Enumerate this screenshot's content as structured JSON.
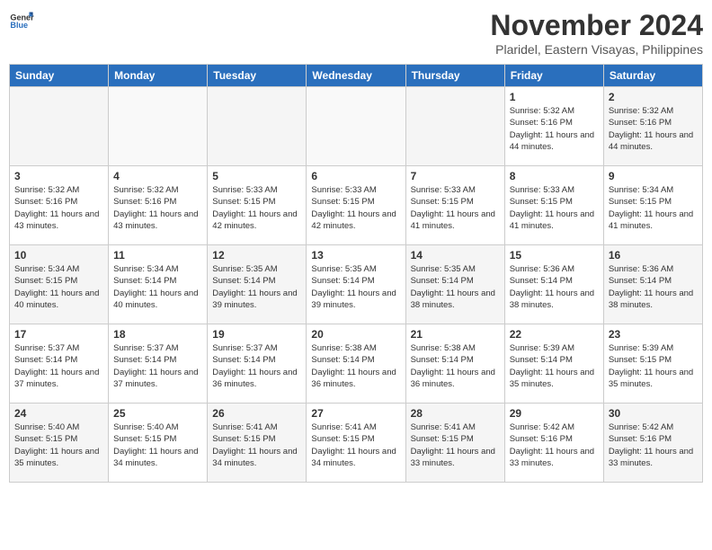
{
  "header": {
    "logo_line1": "General",
    "logo_line2": "Blue",
    "month": "November 2024",
    "location": "Plaridel, Eastern Visayas, Philippines"
  },
  "weekdays": [
    "Sunday",
    "Monday",
    "Tuesday",
    "Wednesday",
    "Thursday",
    "Friday",
    "Saturday"
  ],
  "weeks": [
    [
      {
        "day": "",
        "info": ""
      },
      {
        "day": "",
        "info": ""
      },
      {
        "day": "",
        "info": ""
      },
      {
        "day": "",
        "info": ""
      },
      {
        "day": "",
        "info": ""
      },
      {
        "day": "1",
        "info": "Sunrise: 5:32 AM\nSunset: 5:16 PM\nDaylight: 11 hours\nand 44 minutes."
      },
      {
        "day": "2",
        "info": "Sunrise: 5:32 AM\nSunset: 5:16 PM\nDaylight: 11 hours\nand 44 minutes."
      }
    ],
    [
      {
        "day": "3",
        "info": "Sunrise: 5:32 AM\nSunset: 5:16 PM\nDaylight: 11 hours\nand 43 minutes."
      },
      {
        "day": "4",
        "info": "Sunrise: 5:32 AM\nSunset: 5:16 PM\nDaylight: 11 hours\nand 43 minutes."
      },
      {
        "day": "5",
        "info": "Sunrise: 5:33 AM\nSunset: 5:15 PM\nDaylight: 11 hours\nand 42 minutes."
      },
      {
        "day": "6",
        "info": "Sunrise: 5:33 AM\nSunset: 5:15 PM\nDaylight: 11 hours\nand 42 minutes."
      },
      {
        "day": "7",
        "info": "Sunrise: 5:33 AM\nSunset: 5:15 PM\nDaylight: 11 hours\nand 41 minutes."
      },
      {
        "day": "8",
        "info": "Sunrise: 5:33 AM\nSunset: 5:15 PM\nDaylight: 11 hours\nand 41 minutes."
      },
      {
        "day": "9",
        "info": "Sunrise: 5:34 AM\nSunset: 5:15 PM\nDaylight: 11 hours\nand 41 minutes."
      }
    ],
    [
      {
        "day": "10",
        "info": "Sunrise: 5:34 AM\nSunset: 5:15 PM\nDaylight: 11 hours\nand 40 minutes."
      },
      {
        "day": "11",
        "info": "Sunrise: 5:34 AM\nSunset: 5:14 PM\nDaylight: 11 hours\nand 40 minutes."
      },
      {
        "day": "12",
        "info": "Sunrise: 5:35 AM\nSunset: 5:14 PM\nDaylight: 11 hours\nand 39 minutes."
      },
      {
        "day": "13",
        "info": "Sunrise: 5:35 AM\nSunset: 5:14 PM\nDaylight: 11 hours\nand 39 minutes."
      },
      {
        "day": "14",
        "info": "Sunrise: 5:35 AM\nSunset: 5:14 PM\nDaylight: 11 hours\nand 38 minutes."
      },
      {
        "day": "15",
        "info": "Sunrise: 5:36 AM\nSunset: 5:14 PM\nDaylight: 11 hours\nand 38 minutes."
      },
      {
        "day": "16",
        "info": "Sunrise: 5:36 AM\nSunset: 5:14 PM\nDaylight: 11 hours\nand 38 minutes."
      }
    ],
    [
      {
        "day": "17",
        "info": "Sunrise: 5:37 AM\nSunset: 5:14 PM\nDaylight: 11 hours\nand 37 minutes."
      },
      {
        "day": "18",
        "info": "Sunrise: 5:37 AM\nSunset: 5:14 PM\nDaylight: 11 hours\nand 37 minutes."
      },
      {
        "day": "19",
        "info": "Sunrise: 5:37 AM\nSunset: 5:14 PM\nDaylight: 11 hours\nand 36 minutes."
      },
      {
        "day": "20",
        "info": "Sunrise: 5:38 AM\nSunset: 5:14 PM\nDaylight: 11 hours\nand 36 minutes."
      },
      {
        "day": "21",
        "info": "Sunrise: 5:38 AM\nSunset: 5:14 PM\nDaylight: 11 hours\nand 36 minutes."
      },
      {
        "day": "22",
        "info": "Sunrise: 5:39 AM\nSunset: 5:14 PM\nDaylight: 11 hours\nand 35 minutes."
      },
      {
        "day": "23",
        "info": "Sunrise: 5:39 AM\nSunset: 5:15 PM\nDaylight: 11 hours\nand 35 minutes."
      }
    ],
    [
      {
        "day": "24",
        "info": "Sunrise: 5:40 AM\nSunset: 5:15 PM\nDaylight: 11 hours\nand 35 minutes."
      },
      {
        "day": "25",
        "info": "Sunrise: 5:40 AM\nSunset: 5:15 PM\nDaylight: 11 hours\nand 34 minutes."
      },
      {
        "day": "26",
        "info": "Sunrise: 5:41 AM\nSunset: 5:15 PM\nDaylight: 11 hours\nand 34 minutes."
      },
      {
        "day": "27",
        "info": "Sunrise: 5:41 AM\nSunset: 5:15 PM\nDaylight: 11 hours\nand 34 minutes."
      },
      {
        "day": "28",
        "info": "Sunrise: 5:41 AM\nSunset: 5:15 PM\nDaylight: 11 hours\nand 33 minutes."
      },
      {
        "day": "29",
        "info": "Sunrise: 5:42 AM\nSunset: 5:16 PM\nDaylight: 11 hours\nand 33 minutes."
      },
      {
        "day": "30",
        "info": "Sunrise: 5:42 AM\nSunset: 5:16 PM\nDaylight: 11 hours\nand 33 minutes."
      }
    ]
  ]
}
